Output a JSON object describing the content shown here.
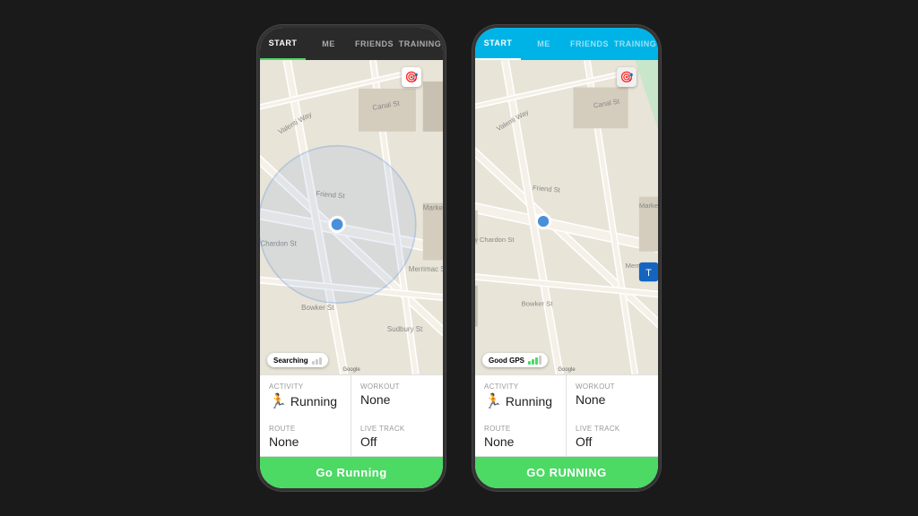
{
  "phones": [
    {
      "id": "phone-dark",
      "theme": "dark",
      "tabs": [
        {
          "label": "START",
          "active": true
        },
        {
          "label": "ME",
          "active": false
        },
        {
          "label": "FRIENDS",
          "active": false
        },
        {
          "label": "TRAINING",
          "active": false
        }
      ],
      "gps_status": "searching",
      "gps_label": "Searching",
      "info": {
        "activity_label": "Activity",
        "activity_value": "Running",
        "workout_label": "Workout",
        "workout_value": "None",
        "route_label": "Route",
        "route_value": "None",
        "livetrack_label": "Live Track",
        "livetrack_value": "Off"
      },
      "go_button": "Go Running"
    },
    {
      "id": "phone-light",
      "theme": "light",
      "tabs": [
        {
          "label": "START",
          "active": true
        },
        {
          "label": "ME",
          "active": false
        },
        {
          "label": "FRIENDS",
          "active": false
        },
        {
          "label": "TRAINING",
          "active": false
        }
      ],
      "gps_status": "good",
      "gps_label": "Good GPS",
      "info": {
        "activity_label": "Activity",
        "activity_value": "Running",
        "workout_label": "Workout",
        "workout_value": "None",
        "route_label": "Route",
        "route_value": "None",
        "livetrack_label": "Live Track",
        "livetrack_value": "Off"
      },
      "go_button": "GO RUNNING"
    }
  ],
  "map_colors": {
    "road": "#ffffff",
    "secondary_road": "#f5f0e8",
    "park": "#c8e6c9",
    "water": "#aaccee",
    "building": "#d4ccbc",
    "background": "#e8e4d8"
  }
}
